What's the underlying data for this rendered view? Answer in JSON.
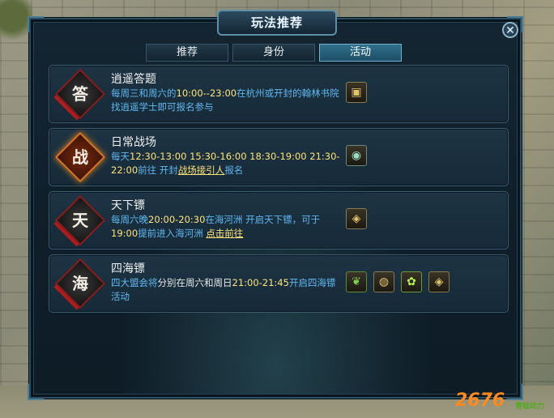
{
  "window": {
    "title": "玩法推荐",
    "close_glyph": "✕"
  },
  "tabs": [
    {
      "label": "推荐",
      "active": false
    },
    {
      "label": "身份",
      "active": false
    },
    {
      "label": "活动",
      "active": true
    }
  ],
  "activities": [
    {
      "badge": "答",
      "title": "逍遥答题",
      "desc": {
        "t1": "每周三和周六的",
        "t2": "10:00--23:00",
        "t3": "在杭州或开封的翰林书院找逍遥学士即可报名参与"
      },
      "rewards": [
        {
          "icon": "treasure-chest-icon",
          "glyph": "▣"
        }
      ]
    },
    {
      "badge": "战",
      "title": "日常战场",
      "desc": {
        "t1": "每天",
        "t2": "12:30-13:00 15:30-16:00 18:30-19:00 21:30-22:00",
        "t3": "前往 开封",
        "t4": "战场接引人",
        "t5": "报名"
      },
      "rewards": [
        {
          "icon": "jade-orb-icon",
          "glyph": "◉"
        }
      ]
    },
    {
      "badge": "天",
      "title": "天下镖",
      "desc": {
        "t1": "每周六晚",
        "t2": "20:00-20:30",
        "t3": "在海河洲 开启天下镖，可于",
        "t4": "19:00",
        "t5": "提前进入海河洲 ",
        "t6": "点击前往"
      },
      "rewards": [
        {
          "icon": "gold-coin-icon",
          "glyph": "◈"
        }
      ]
    },
    {
      "badge": "海",
      "title": "四海镖",
      "desc": {
        "t1": "四大盟会将",
        "t2": "分别在周六和周日",
        "t3": "21:00-21:45",
        "t4": "开启四海镖活动"
      },
      "rewards": [
        {
          "icon": "green-leaf-icon",
          "glyph": "❦"
        },
        {
          "icon": "ingot-stack-icon",
          "glyph": "◍"
        },
        {
          "icon": "green-spirit-icon",
          "glyph": "✿"
        },
        {
          "icon": "gold-coin-icon",
          "glyph": "◈"
        }
      ]
    }
  ],
  "watermark": {
    "text": "2676",
    "sub": "青蛙动力"
  },
  "colors": {
    "accent_text": "#5fb8f0",
    "highlight_text": "#ffe37a",
    "active_tab": "#2f6f8c"
  }
}
